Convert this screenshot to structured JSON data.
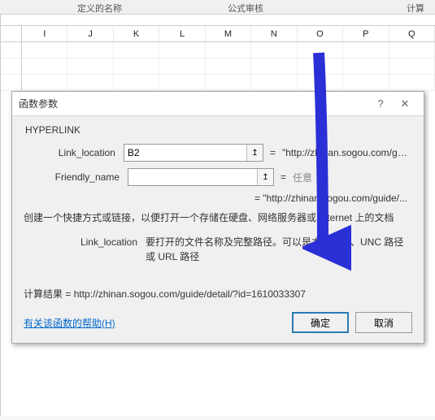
{
  "ribbon": {
    "group1": "定义的名称",
    "group2": "公式审核",
    "group3": "计算"
  },
  "columns": [
    "I",
    "J",
    "K",
    "L",
    "M",
    "N",
    "O",
    "P",
    "Q"
  ],
  "dialog": {
    "title": "函数参数",
    "funcName": "HYPERLINK",
    "arg1": {
      "label": "Link_location",
      "value": "B2",
      "result": "\"http://zhinan.sogou.com/guide/..."
    },
    "arg2": {
      "label": "Friendly_name",
      "value": "",
      "result": "任意"
    },
    "evalLine": "=   \"http://zhinan.sogou.com/guide/...",
    "desc": "创建一个快捷方式或链接，以便打开一个存储在硬盘、网络服务器或  Internet 上的文档",
    "argDesc": {
      "label": "Link_location",
      "text": "要打开的文件名称及完整路径。可以是本地硬盘、UNC 路径或 URL 路径"
    },
    "resultLabel": "计算结果 = ",
    "resultValue": "http://zhinan.sogou.com/guide/detail/?id=1610033307",
    "helpLink": "有关该函数的帮助(H)",
    "ok": "确定",
    "cancel": "取消"
  },
  "icons": {
    "help": "?",
    "close": "✕",
    "refUp": "↥"
  }
}
